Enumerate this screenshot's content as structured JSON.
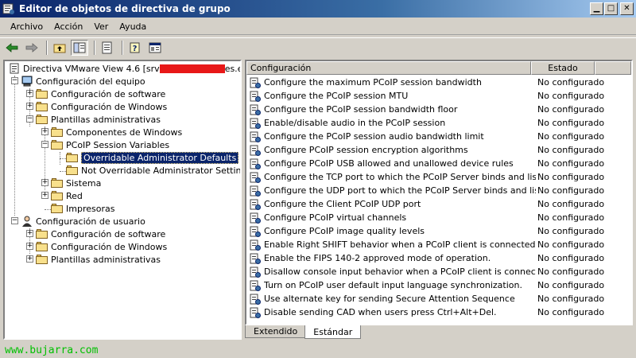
{
  "window": {
    "title": "Editor de objetos de directiva de grupo",
    "accent": "#0a246a"
  },
  "menu": [
    {
      "label": "Archivo"
    },
    {
      "label": "Acción"
    },
    {
      "label": "Ver"
    },
    {
      "label": "Ayuda"
    }
  ],
  "toolbar": [
    {
      "icon": "back-arrow-icon"
    },
    {
      "icon": "forward-arrow-icon"
    },
    {
      "icon": "up-folder-icon"
    },
    {
      "icon": "show-hide-tree-icon",
      "pressed": true
    },
    {
      "icon": "export-list-icon"
    },
    {
      "icon": "help-icon"
    },
    {
      "icon": "properties-icon"
    }
  ],
  "tree": {
    "root_prefix": "Directiva VMware View 4.6 [srv",
    "root_suffix": "es.es]",
    "items": [
      {
        "label": "Configuración del equipo"
      },
      {
        "label": "Configuración de software"
      },
      {
        "label": "Configuración de Windows"
      },
      {
        "label": "Plantillas administrativas"
      },
      {
        "label": "Componentes de Windows"
      },
      {
        "label": "PCoIP Session Variables"
      },
      {
        "label": "Overridable Administrator Defaults",
        "selected": true
      },
      {
        "label": "Not Overridable Administrator Settings"
      },
      {
        "label": "Sistema"
      },
      {
        "label": "Red"
      },
      {
        "label": "Impresoras"
      },
      {
        "label": "Configuración de usuario"
      },
      {
        "label": "Configuración de software"
      },
      {
        "label": "Configuración de Windows"
      },
      {
        "label": "Plantillas administrativas"
      }
    ]
  },
  "list": {
    "columns": [
      "Configuración",
      "Estado"
    ],
    "rows": [
      {
        "name": "Configure the maximum PCoIP session bandwidth",
        "state": "No configurado"
      },
      {
        "name": "Configure the PCoIP session MTU",
        "state": "No configurado"
      },
      {
        "name": "Configure the PCoIP session bandwidth floor",
        "state": "No configurado"
      },
      {
        "name": "Enable/disable audio in the PCoIP session",
        "state": "No configurado"
      },
      {
        "name": "Configure the PCoIP session audio bandwidth limit",
        "state": "No configurado"
      },
      {
        "name": "Configure PCoIP session encryption algorithms",
        "state": "No configurado"
      },
      {
        "name": "Configure PCoIP USB allowed and unallowed device rules",
        "state": "No configurado"
      },
      {
        "name": "Configure the TCP port to which the PCoIP Server binds and listens",
        "state": "No configurado"
      },
      {
        "name": "Configure the UDP port to which the PCoIP Server binds and listens",
        "state": "No configurado"
      },
      {
        "name": "Configure the Client PCoIP UDP port",
        "state": "No configurado"
      },
      {
        "name": "Configure PCoIP virtual channels",
        "state": "No configurado"
      },
      {
        "name": "Configure PCoIP image quality levels",
        "state": "No configurado"
      },
      {
        "name": "Enable Right SHIFT behavior when a PCoIP client is connected.",
        "state": "No configurado"
      },
      {
        "name": "Enable the FIPS 140-2 approved mode of operation.",
        "state": "No configurado"
      },
      {
        "name": "Disallow console input behavior when a PCoIP client is connected.",
        "state": "No configurado"
      },
      {
        "name": "Turn on PCoIP user default input language synchronization.",
        "state": "No configurado"
      },
      {
        "name": "Use alternate key for sending Secure Attention Sequence",
        "state": "No configurado"
      },
      {
        "name": "Disable sending CAD when users press Ctrl+Alt+Del.",
        "state": "No configurado"
      }
    ]
  },
  "tabs": [
    {
      "label": "Extendido"
    },
    {
      "label": "Estándar",
      "active": true
    }
  ],
  "watermark": "www.bujarra.com"
}
